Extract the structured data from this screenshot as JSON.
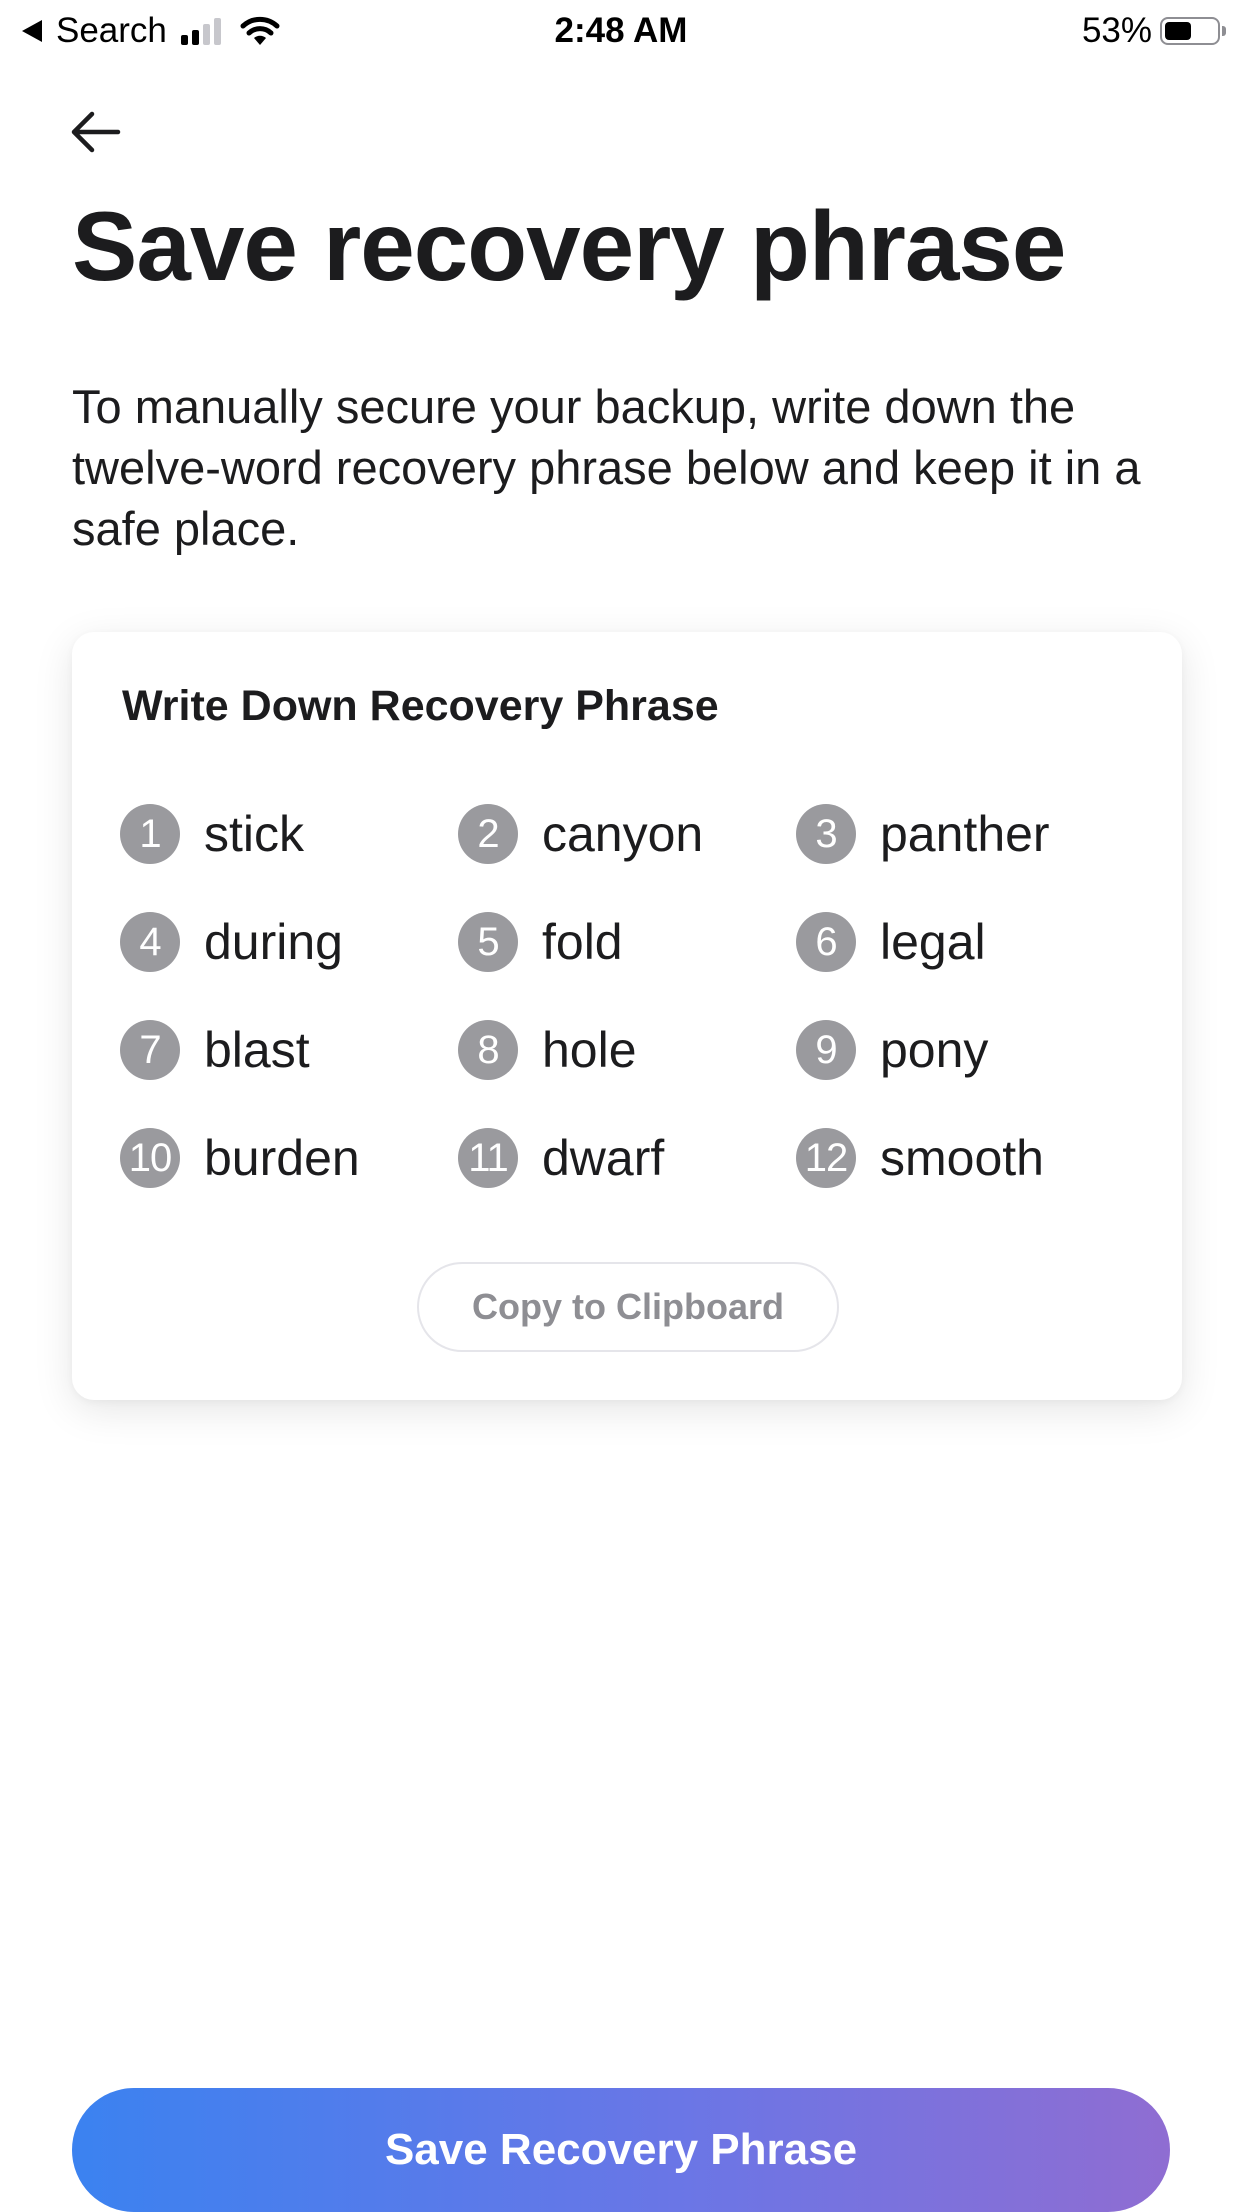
{
  "status_bar": {
    "back_label": "Search",
    "time": "2:48 AM",
    "battery_percent": "53%",
    "battery_level": 0.53,
    "signal_bars_active": 2,
    "signal_bars_total": 4
  },
  "header": {
    "back_icon": "arrow-left-icon",
    "title": "Save recovery phrase",
    "description": "To manually secure your backup, write down the twelve-word recovery phrase below and keep it in a safe place."
  },
  "card": {
    "title": "Write Down Recovery Phrase",
    "words": [
      {
        "num": "1",
        "word": "stick"
      },
      {
        "num": "2",
        "word": "canyon"
      },
      {
        "num": "3",
        "word": "panther"
      },
      {
        "num": "4",
        "word": "during"
      },
      {
        "num": "5",
        "word": "fold"
      },
      {
        "num": "6",
        "word": "legal"
      },
      {
        "num": "7",
        "word": "blast"
      },
      {
        "num": "8",
        "word": "hole"
      },
      {
        "num": "9",
        "word": "pony"
      },
      {
        "num": "10",
        "word": "burden"
      },
      {
        "num": "11",
        "word": "dwarf"
      },
      {
        "num": "12",
        "word": "smooth"
      }
    ],
    "copy_label": "Copy to Clipboard"
  },
  "footer": {
    "save_label": "Save Recovery Phrase"
  },
  "colors": {
    "primary_gradient_start": "#3b82f0",
    "primary_gradient_end": "#8f6dd2",
    "number_badge": "#9a9a9e",
    "text_primary": "#1c1c1e"
  }
}
